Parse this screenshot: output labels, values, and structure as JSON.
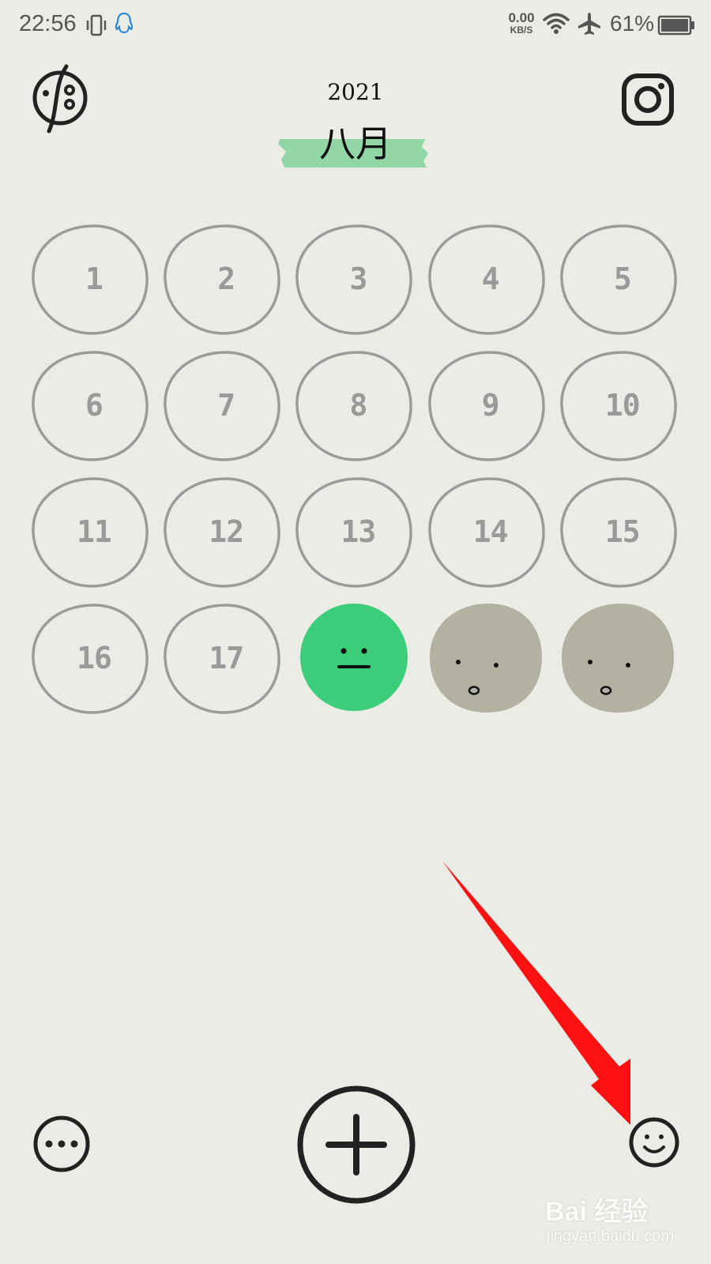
{
  "status_bar": {
    "time": "22:56",
    "net_speed_value": "0.00",
    "net_speed_unit": "KB/S",
    "battery": "61%",
    "icons": [
      "vibrate-icon",
      "qq-icon",
      "wifi-icon",
      "airplane-icon",
      "battery-icon"
    ]
  },
  "header": {
    "year": "2021",
    "month": "八月",
    "tape_color": "#93d6a6",
    "left_icon": "mood-logo-icon",
    "right_icon": "instagram-icon"
  },
  "calendar": {
    "ring_color": "#9b9b9b",
    "number_color": "#9a9a9a",
    "rows": [
      [
        {
          "label": "1"
        },
        {
          "label": "2"
        },
        {
          "label": "3"
        },
        {
          "label": "4"
        },
        {
          "label": "5"
        }
      ],
      [
        {
          "label": "6"
        },
        {
          "label": "7"
        },
        {
          "label": "8"
        },
        {
          "label": "9"
        },
        {
          "label": "10"
        }
      ],
      [
        {
          "label": "11"
        },
        {
          "label": "12"
        },
        {
          "label": "13"
        },
        {
          "label": "14"
        },
        {
          "label": "15"
        }
      ],
      [
        {
          "label": "16"
        },
        {
          "label": "17"
        },
        {
          "mood": "neutral",
          "color": "#3ccd7a"
        },
        {
          "mood": "surprised",
          "color": "#b2b1a2"
        },
        {
          "mood": "surprised",
          "color": "#b2b1a2"
        }
      ]
    ]
  },
  "bottom_bar": {
    "more_icon": "more-dots-icon",
    "add_icon": "add-plus-icon",
    "mood_icon": "smiley-icon"
  },
  "annotation": {
    "arrow_color": "#ff1111"
  },
  "watermark": {
    "main": "Bai 经验",
    "sub": "jingyan.baidu.com"
  }
}
